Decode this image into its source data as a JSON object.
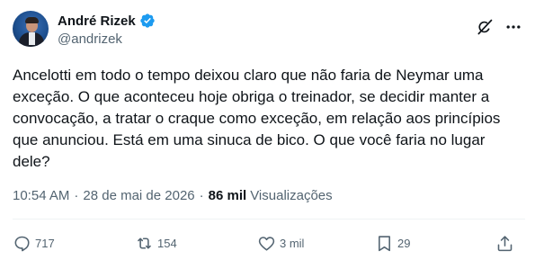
{
  "author": {
    "name": "André Rizek",
    "handle": "@andrizek"
  },
  "tweet": {
    "text": "Ancelotti em todo o tempo deixou claro que não faria de Neymar uma\nexceção. O que aconteceu hoje obriga o treinador, se decidir manter a\nconvocação, a tratar o craque como exceção, em relação aos princípios\nque anunciou. Está em uma sinuca de bico. O que você faria no lugar\ndele?",
    "time": "10:54 AM",
    "date": "28 de mai de 2026",
    "separator": "·",
    "views_count": "86 mil",
    "views_label": "Visualizações"
  },
  "actions": {
    "replies": "717",
    "reposts": "154",
    "likes": "3 mil",
    "bookmarks": "29"
  },
  "colors": {
    "text": "#0f1419",
    "secondary": "#536471",
    "verified": "#1d9bf0",
    "divider": "#eff3f4"
  },
  "icons": [
    "verified-badge-icon",
    "grok-icon",
    "more-icon",
    "reply-icon",
    "repost-icon",
    "like-icon",
    "bookmark-icon",
    "share-icon"
  ]
}
